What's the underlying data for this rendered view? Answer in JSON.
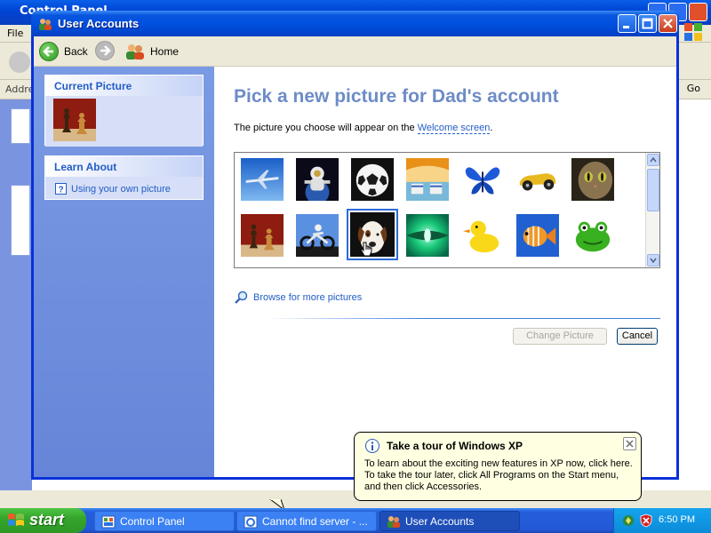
{
  "background_window": {
    "title": "Control Panel",
    "menu_first": "File",
    "address_label": "Address",
    "go_label": "Go"
  },
  "window": {
    "title": "User Accounts"
  },
  "nav": {
    "back_label": "Back",
    "home_label": "Home"
  },
  "left_pane": {
    "current_picture_header": "Current Picture",
    "learn_about_header": "Learn About",
    "learn_item": "Using your own picture"
  },
  "main": {
    "heading": "Pick a new picture for Dad's account",
    "description_prefix": "The picture you choose will appear on the ",
    "description_link": "Welcome screen",
    "description_suffix": ".",
    "pictures": [
      {
        "name": "airplane",
        "color": "#2d7fd8"
      },
      {
        "name": "astronaut",
        "color": "#1a1a2a"
      },
      {
        "name": "soccer-ball",
        "color": "#1e1e1e"
      },
      {
        "name": "beach-chairs",
        "color": "#f0a020"
      },
      {
        "name": "butterfly",
        "color": "#1e64d8"
      },
      {
        "name": "race-car",
        "color": "#e8b820"
      },
      {
        "name": "cat",
        "color": "#6b5a3c"
      },
      {
        "name": "chess",
        "color": "#a01a10"
      },
      {
        "name": "dirt-bike",
        "color": "#3a70c8"
      },
      {
        "name": "dog",
        "color": "#1a1a1a"
      },
      {
        "name": "green-abstract",
        "color": "#18c878"
      },
      {
        "name": "rubber-duck",
        "color": "#f8d818"
      },
      {
        "name": "fish",
        "color": "#2060d0"
      },
      {
        "name": "frog",
        "color": "#38b020"
      }
    ],
    "selected_picture": "dog",
    "browse_label": "Browse for more pictures",
    "change_button": "Change Picture",
    "cancel_button": "Cancel"
  },
  "balloon": {
    "title": "Take a tour of Windows XP",
    "line1": "To learn about the exciting new features in XP now, click here.",
    "line2": "To take the tour later, click All Programs on the Start menu,",
    "line3": "and then click Accessories."
  },
  "taskbar": {
    "start_label": "start",
    "tasks": [
      {
        "label": "Control Panel"
      },
      {
        "label": "Cannot find server - ..."
      },
      {
        "label": "User Accounts"
      }
    ],
    "clock": "6:50 PM"
  },
  "colors": {
    "heading": "#6d8cc7",
    "link": "#215dc6",
    "titlebar": "#0050e0",
    "taskbar": "#245edb"
  }
}
